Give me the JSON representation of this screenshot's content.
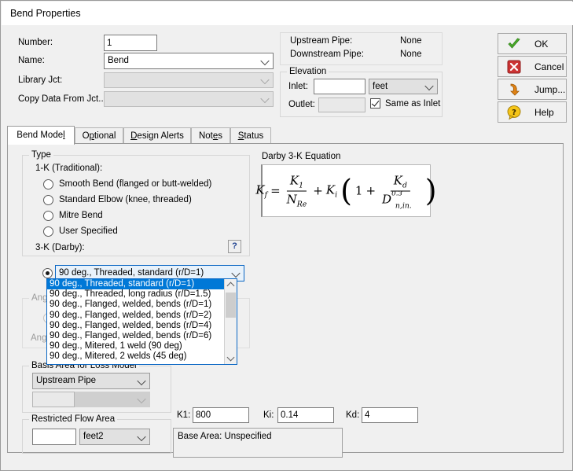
{
  "window": {
    "title": "Bend Properties"
  },
  "form": {
    "number_label": "Number:",
    "number_value": "1",
    "name_label": "Name:",
    "name_value": "Bend",
    "library_label": "Library Jct:",
    "library_value": "",
    "copy_label": "Copy Data From Jct...",
    "copy_value": ""
  },
  "pipes": {
    "upstream_label": "Upstream Pipe:",
    "upstream_value": "None",
    "downstream_label": "Downstream Pipe:",
    "downstream_value": "None"
  },
  "elevation": {
    "group_title": "Elevation",
    "inlet_label": "Inlet:",
    "inlet_value": "",
    "units_value": "feet",
    "outlet_label": "Outlet:",
    "outlet_value": "",
    "same_as_inlet_label": "Same as Inlet",
    "same_as_inlet_checked": true
  },
  "buttons": [
    {
      "label": "OK",
      "icon": "green-check-icon"
    },
    {
      "label": "Cancel",
      "icon": "red-x-icon"
    },
    {
      "label": "Jump...",
      "icon": "orange-arrow-icon"
    },
    {
      "label": "Help",
      "icon": "yellow-question-icon"
    }
  ],
  "tabs": [
    {
      "label": "Bend Model",
      "accel": "l",
      "active": true
    },
    {
      "label": "Optional",
      "accel": "p",
      "active": false
    },
    {
      "label": "Design Alerts",
      "accel": "D",
      "active": false
    },
    {
      "label": "Notes",
      "accel": "e",
      "active": false
    },
    {
      "label": "Status",
      "accel": "S",
      "active": false
    }
  ],
  "type_group": {
    "title": "Type",
    "onek_label": "1-K (Traditional):",
    "options": [
      {
        "label": "Smooth Bend (flanged or butt-welded)",
        "checked": false
      },
      {
        "label": "Standard Elbow (knee, threaded)",
        "checked": false
      },
      {
        "label": "Mitre Bend",
        "checked": false
      },
      {
        "label": "User Specified",
        "checked": false
      }
    ],
    "threek_label": "3-K (Darby):",
    "help_label": "?",
    "threek_checked": true,
    "threek_selected": "90 deg., Threaded, standard (r/D=1)"
  },
  "dropdown": {
    "open": true,
    "options": [
      "90 deg., Threaded, standard (r/D=1)",
      "90 deg., Threaded, long radius (r/D=1.5)",
      "90 deg., Flanged, welded, bends (r/D=1)",
      "90 deg., Flanged, welded, bends (r/D=2)",
      "90 deg., Flanged, welded, bends (r/D=4)",
      "90 deg., Flanged, welded, bends (r/D=6)",
      "90 deg., Mitered, 1 weld (90 deg)",
      "90 deg., Mitered, 2 welds (45 deg)"
    ],
    "selected_index": 0
  },
  "angle_group": {
    "title": "Angle",
    "radio_label": "",
    "radio_checked": true,
    "sub_label": "Angle",
    "disabled": true
  },
  "basis_group": {
    "title": "Basis Area for Loss Model",
    "selected": "Upstream Pipe",
    "value": "",
    "units": ""
  },
  "restricted_group": {
    "title": "Restricted Flow Area",
    "value": "",
    "units": "feet2"
  },
  "k_values": {
    "k1_label": "K1:",
    "k1_value": "800",
    "ki_label": "Ki:",
    "ki_value": "0.14",
    "kd_label": "Kd:",
    "kd_value": "4"
  },
  "base_area": {
    "text": "Base Area: Unspecified"
  },
  "equation": {
    "title": "Darby 3-K Equation",
    "latex": "Kf = K1/NRe + Ki(1 + Kd/D^0.3 n,in.)",
    "kf": "K",
    "kf_sub": "f",
    "k1": "K",
    "k1_sub": "1",
    "nre": "N",
    "nre_sub": "Re",
    "ki": "K",
    "ki_sub": "i",
    "one": "1",
    "kd": "K",
    "kd_sub": "d",
    "d": "D",
    "d_sub": "n,in.",
    "d_sup": "0.3",
    "eq_sign": "=",
    "plus1": "+",
    "plus2": "+"
  },
  "colors": {
    "dialog_bg": "#f0f0f0",
    "accent_blue": "#0078d7",
    "dropdown_border": "#0b67c4",
    "ok_green": "#4caf2a",
    "cancel_red": "#cc3333",
    "jump_orange": "#e08214",
    "help_yellow": "#f5c518"
  }
}
